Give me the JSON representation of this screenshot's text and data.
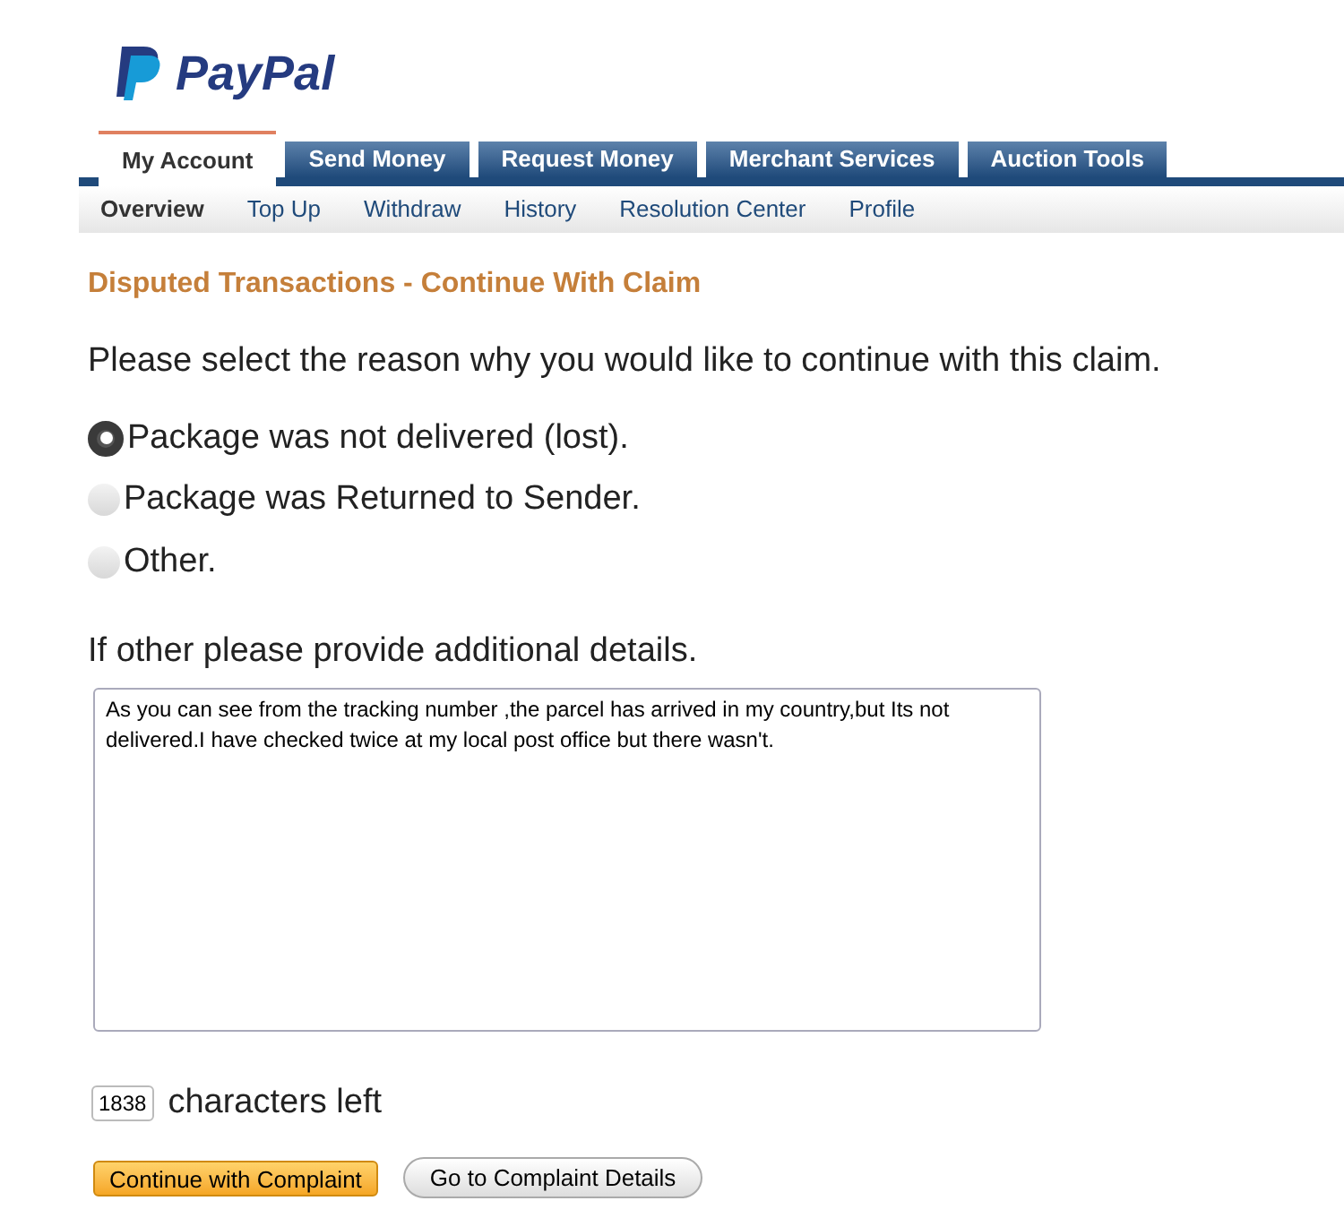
{
  "logo": {
    "text": "PayPal"
  },
  "tabs": [
    {
      "label": "My Account",
      "selected": true
    },
    {
      "label": "Send Money",
      "selected": false
    },
    {
      "label": "Request Money",
      "selected": false
    },
    {
      "label": "Merchant Services",
      "selected": false
    },
    {
      "label": "Auction Tools",
      "selected": false
    }
  ],
  "subnav": [
    {
      "label": "Overview",
      "selected": true
    },
    {
      "label": "Top Up",
      "selected": false
    },
    {
      "label": "Withdraw",
      "selected": false
    },
    {
      "label": "History",
      "selected": false
    },
    {
      "label": "Resolution Center",
      "selected": false
    },
    {
      "label": "Profile",
      "selected": false
    }
  ],
  "heading": "Disputed Transactions - Continue With Claim",
  "prompt": "Please select the reason why you would like to continue with this claim.",
  "reasons": [
    {
      "label": "Package was not delivered (lost).",
      "selected": true
    },
    {
      "label": "Package was Returned to Sender.",
      "selected": false
    },
    {
      "label": "Other.",
      "selected": false
    }
  ],
  "details": {
    "label": "If other please provide additional details.",
    "value": "As you can see from the tracking number ,the parcel has arrived in my country,but Its not delivered.I have checked twice at my local post office but there wasn't."
  },
  "counter": {
    "value": "1838",
    "label": "characters left"
  },
  "buttons": [
    {
      "label": "Continue with Complaint",
      "kind": "primary"
    },
    {
      "label": "Go to Complaint Details",
      "kind": "secondary"
    }
  ]
}
